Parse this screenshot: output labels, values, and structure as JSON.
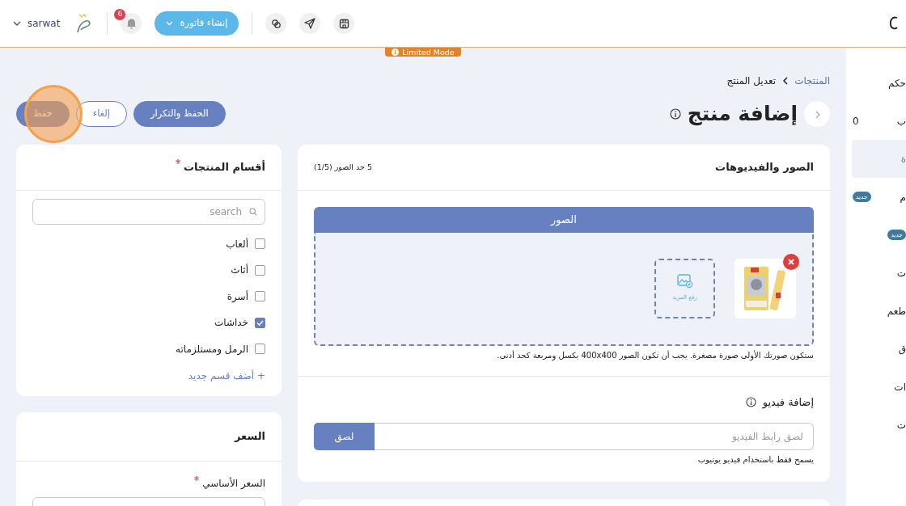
{
  "header": {
    "user": "sarwat",
    "notifications": "6",
    "create_button": "إنشاء فاتورة"
  },
  "mode_badge": "Limited Mode",
  "breadcrumb": [
    {
      "label": "المنتجات",
      "kind": "link"
    },
    {
      "label": "تعديل المنتج",
      "kind": "current"
    }
  ],
  "title": "إضافة منتج",
  "actions": [
    {
      "label": "الحفظ والتكرار",
      "kind": "primary",
      "clicked": false
    },
    {
      "label": "إلغاء",
      "kind": "outline",
      "clicked": false
    },
    {
      "label": "حفظ",
      "kind": "primary",
      "clicked": true
    }
  ],
  "media": {
    "title": "الصور والفيديوهات",
    "limit": "5 حد الصور (1/5)",
    "tab": "الصور",
    "upload_label": "رفع المزيد",
    "note": "ستكون صورتك الأولى صورة مصغرة. يجب أن تكون الصور 400x400 بكسل ومربعة كحد أدنى.",
    "video_title": "إضافة فيديو",
    "video_placeholder": "لصق رابط الفيديو",
    "paste_button": "لصق",
    "video_note": "يسمح فقط باستخدام فيديو يوتيوب"
  },
  "categories": {
    "title": "أقسام المنتجات",
    "required": true,
    "search_placeholder": "search",
    "items": [
      {
        "label": "ألعاب",
        "checked": false
      },
      {
        "label": "أثاث",
        "checked": false
      },
      {
        "label": "أسرة",
        "checked": false
      },
      {
        "label": "خداشات",
        "checked": true
      },
      {
        "label": "الرمل ومستلزماته",
        "checked": false
      }
    ],
    "add_link": "+ أضف قسم جديد"
  },
  "price": {
    "title": "السعر",
    "base_price_label": "السعر الأساسي",
    "required": true
  },
  "sidebar": {
    "items": [
      {
        "label": "حكم",
        "selected": false
      },
      {
        "label": "ب",
        "count": "0",
        "selected": false
      },
      {
        "label": "ة",
        "selected": true
      },
      {
        "label": "م",
        "badge": "جديد",
        "selected": false
      },
      {
        "badge": "جديد",
        "selected": false
      },
      {
        "label": "ت",
        "selected": false
      },
      {
        "label": "طعم",
        "selected": false
      },
      {
        "label": "ق",
        "selected": false
      },
      {
        "label": "ات",
        "selected": false
      },
      {
        "label": "ت",
        "selected": false
      }
    ]
  }
}
